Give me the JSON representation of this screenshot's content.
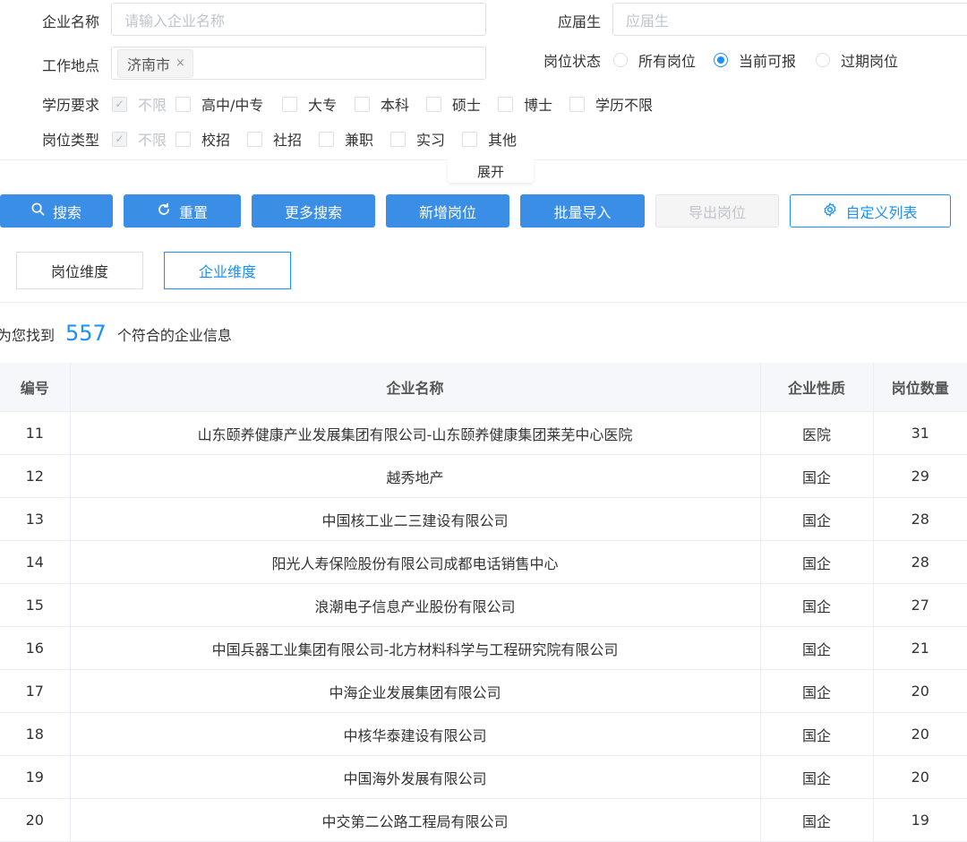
{
  "filters": {
    "company_name_label": "企业名称",
    "company_name_placeholder": "请输入企业名称",
    "fresh_grad_label": "应届生",
    "fresh_grad_placeholder": "应届生",
    "location_label": "工作地点",
    "location_tag": "济南市",
    "tag_close": "×",
    "status_label": "岗位状态",
    "status_options": [
      "所有岗位",
      "当前可报",
      "过期岗位"
    ],
    "status_selected": "当前可报",
    "education_label": "学历要求",
    "education_options": [
      "不限",
      "高中/中专",
      "大专",
      "本科",
      "硕士",
      "博士",
      "学历不限"
    ],
    "type_label": "岗位类型",
    "type_options": [
      "不限",
      "校招",
      "社招",
      "兼职",
      "实习",
      "其他"
    ],
    "expand_label": "展开"
  },
  "toolbar": {
    "search": "搜索",
    "reset": "重置",
    "more_search": "更多搜索",
    "add_job": "新增岗位",
    "batch_import": "批量导入",
    "export_jobs": "导出岗位",
    "custom_list": "自定义列表"
  },
  "view_tabs": {
    "job_dimension": "岗位维度",
    "company_dimension": "企业维度",
    "active": "企业维度"
  },
  "result": {
    "prefix": "为您找到",
    "count": "557",
    "suffix": "个符合的企业信息"
  },
  "table": {
    "headers": [
      "编号",
      "企业名称",
      "企业性质",
      "岗位数量"
    ],
    "rows": [
      {
        "id": "11",
        "name": "山东颐养健康产业发展集团有限公司-山东颐养健康集团莱芜中心医院",
        "type": "医院",
        "count": "31"
      },
      {
        "id": "12",
        "name": "越秀地产",
        "type": "国企",
        "count": "29"
      },
      {
        "id": "13",
        "name": "中国核工业二三建设有限公司",
        "type": "国企",
        "count": "28"
      },
      {
        "id": "14",
        "name": "阳光人寿保险股份有限公司成都电话销售中心",
        "type": "国企",
        "count": "28"
      },
      {
        "id": "15",
        "name": "浪潮电子信息产业股份有限公司",
        "type": "国企",
        "count": "27"
      },
      {
        "id": "16",
        "name": "中国兵器工业集团有限公司-北方材料科学与工程研究院有限公司",
        "type": "国企",
        "count": "21"
      },
      {
        "id": "17",
        "name": "中海企业发展集团有限公司",
        "type": "国企",
        "count": "20"
      },
      {
        "id": "18",
        "name": "中核华泰建设有限公司",
        "type": "国企",
        "count": "20"
      },
      {
        "id": "19",
        "name": "中国海外发展有限公司",
        "type": "国企",
        "count": "20"
      },
      {
        "id": "20",
        "name": "中交第二公路工程局有限公司",
        "type": "国企",
        "count": "19"
      }
    ]
  },
  "colors": {
    "primary": "#3a8ee6",
    "accent_blue": "#1890ff",
    "header_bg": "#f5f7fa"
  }
}
